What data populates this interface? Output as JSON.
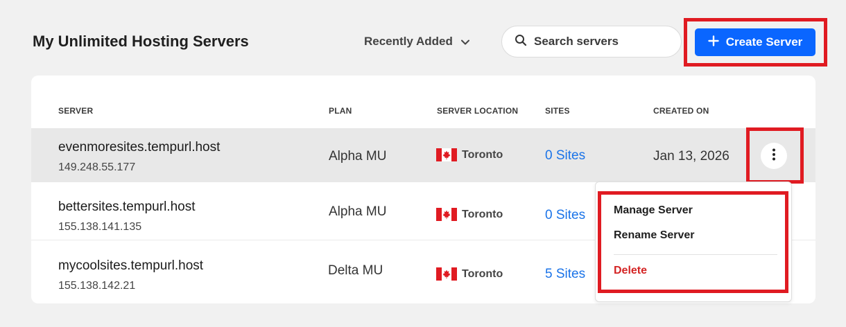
{
  "header": {
    "title": "My Unlimited Hosting Servers",
    "sort_label": "Recently Added",
    "search_placeholder": "Search servers",
    "create_label": "Create Server"
  },
  "table": {
    "columns": [
      "SERVER",
      "PLAN",
      "SERVER LOCATION",
      "SITES",
      "CREATED ON"
    ],
    "rows": [
      {
        "name": "evenmoresites.tempurl.host",
        "ip": "149.248.55.177",
        "plan": "Alpha MU",
        "location": "Toronto",
        "sites": "0 Sites",
        "created": "Jan 13, 2026"
      },
      {
        "name": "bettersites.tempurl.host",
        "ip": "155.138.141.135",
        "plan": "Alpha MU",
        "location": "Toronto",
        "sites": "0 Sites",
        "created": ""
      },
      {
        "name": "mycoolsites.tempurl.host",
        "ip": "155.138.142.21",
        "plan": "Delta MU",
        "location": "Toronto",
        "sites": "5 Sites",
        "created": ""
      }
    ]
  },
  "menu": {
    "items": [
      "Manage Server",
      "Rename Server",
      "Delete"
    ]
  },
  "colors": {
    "accent": "#0a66ff",
    "highlight": "#e01b22",
    "link": "#1a73e8",
    "danger": "#d42424"
  },
  "icons": [
    "chevron-down-icon",
    "search-icon",
    "plus-icon",
    "canada-flag-icon",
    "kebab-menu-icon"
  ]
}
